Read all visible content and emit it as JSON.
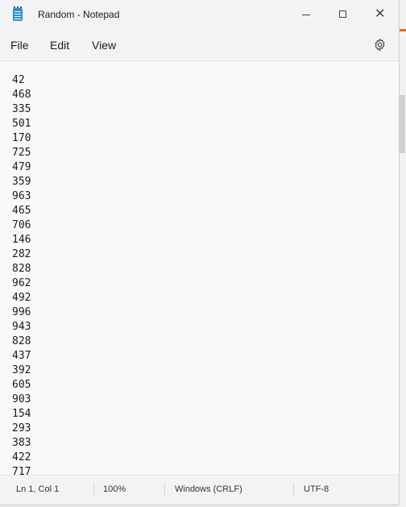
{
  "window": {
    "title": "Random - Notepad"
  },
  "menu": {
    "file": "File",
    "edit": "Edit",
    "view": "View"
  },
  "icons": {
    "app": "notepad-icon",
    "minimize": "minimize-icon",
    "maximize": "maximize-icon",
    "close": "close-icon",
    "settings": "gear-icon"
  },
  "editor": {
    "lines": [
      "42",
      "468",
      "335",
      "501",
      "170",
      "725",
      "479",
      "359",
      "963",
      "465",
      "706",
      "146",
      "282",
      "828",
      "962",
      "492",
      "996",
      "943",
      "828",
      "437",
      "392",
      "605",
      "903",
      "154",
      "293",
      "383",
      "422",
      "717"
    ]
  },
  "status": {
    "position": "Ln 1, Col 1",
    "zoom": "100%",
    "line_ending": "Windows (CRLF)",
    "encoding": "UTF-8"
  },
  "colors": {
    "app_icon": "#2b8fd6",
    "background_accent": "#e86a1e"
  }
}
